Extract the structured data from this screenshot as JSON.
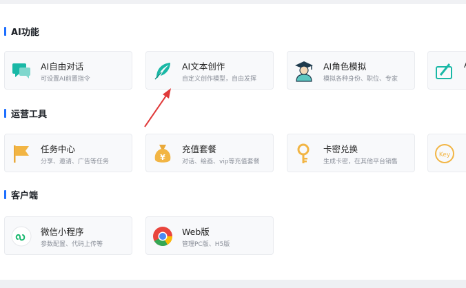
{
  "sections": [
    {
      "title": "AI功能",
      "cards": [
        {
          "title": "AI自由对话",
          "desc": "可设置AI前置指令",
          "icon": "chat-bubble-icon"
        },
        {
          "title": "AI文本创作",
          "desc": "自定义创作模型，自由发挥",
          "icon": "feather-icon"
        },
        {
          "title": "AI角色模拟",
          "desc": "模拟各种身份、职位、专家",
          "icon": "graduate-avatar-icon"
        },
        {
          "title": "A",
          "desc": "",
          "icon": "painting-icon"
        }
      ]
    },
    {
      "title": "运营工具",
      "cards": [
        {
          "title": "任务中心",
          "desc": "分享、邀请、广告等任务",
          "icon": "flag-icon"
        },
        {
          "title": "充值套餐",
          "desc": "对话、绘画、vip等充值套餐",
          "icon": "money-bag-icon"
        },
        {
          "title": "卡密兑换",
          "desc": "生成卡密，在其他平台销售",
          "icon": "key-icon"
        },
        {
          "title": "Key",
          "desc": "",
          "icon": "key-badge-icon"
        }
      ]
    },
    {
      "title": "客户端",
      "cards": [
        {
          "title": "微信小程序",
          "desc": "参数配置、代码上传等",
          "icon": "mini-program-icon"
        },
        {
          "title": "Web版",
          "desc": "管理PC版、H5版",
          "icon": "chrome-icon"
        }
      ]
    }
  ],
  "colors": {
    "accent": "#1e6fff",
    "teal": "#19b8a6",
    "gold": "#f2b544",
    "arrow": "#e03a3a"
  }
}
